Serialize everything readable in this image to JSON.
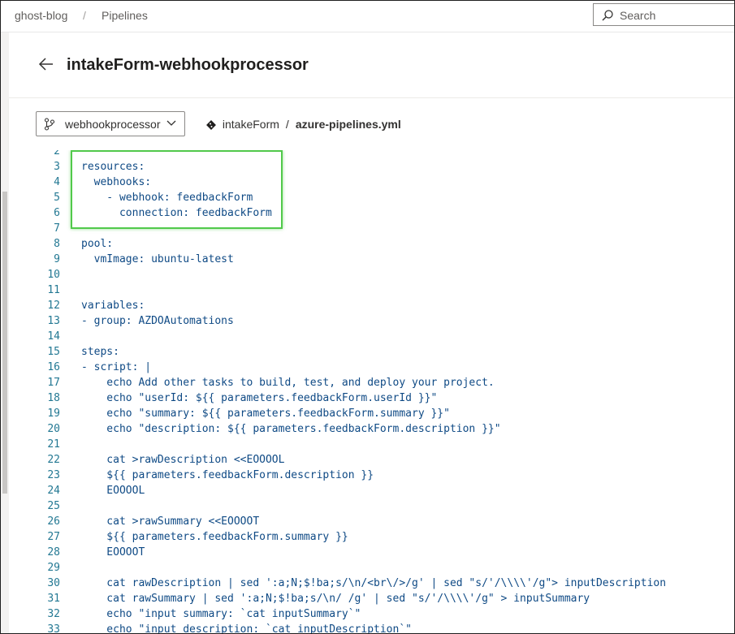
{
  "breadcrumb": {
    "project": "ghost-blog",
    "separator": "/",
    "section": "Pipelines"
  },
  "search": {
    "placeholder": "Search"
  },
  "page": {
    "title": "intakeForm-webhookprocessor"
  },
  "branch": {
    "name": "webhookprocessor"
  },
  "filepath": {
    "repo": "intakeForm",
    "separator": "/",
    "file": "azure-pipelines.yml"
  },
  "colors": {
    "highlight_border": "#51c94b",
    "code_text": "#0f4a85",
    "line_number": "#237893"
  },
  "code_lines": [
    {
      "n": "2",
      "t": ""
    },
    {
      "n": "3",
      "t": "resources:"
    },
    {
      "n": "4",
      "t": "  webhooks:"
    },
    {
      "n": "5",
      "t": "    - webhook: feedbackForm"
    },
    {
      "n": "6",
      "t": "      connection: feedbackForm"
    },
    {
      "n": "7",
      "t": ""
    },
    {
      "n": "8",
      "t": "pool:"
    },
    {
      "n": "9",
      "t": "  vmImage: ubuntu-latest"
    },
    {
      "n": "10",
      "t": ""
    },
    {
      "n": "11",
      "t": ""
    },
    {
      "n": "12",
      "t": "variables:"
    },
    {
      "n": "13",
      "t": "- group: AZDOAutomations"
    },
    {
      "n": "14",
      "t": ""
    },
    {
      "n": "15",
      "t": "steps:"
    },
    {
      "n": "16",
      "t": "- script: |"
    },
    {
      "n": "17",
      "t": "    echo Add other tasks to build, test, and deploy your project."
    },
    {
      "n": "18",
      "t": "    echo \"userId: ${{ parameters.feedbackForm.userId }}\""
    },
    {
      "n": "19",
      "t": "    echo \"summary: ${{ parameters.feedbackForm.summary }}\""
    },
    {
      "n": "20",
      "t": "    echo \"description: ${{ parameters.feedbackForm.description }}\""
    },
    {
      "n": "21",
      "t": ""
    },
    {
      "n": "22",
      "t": "    cat >rawDescription <<EOOOOL"
    },
    {
      "n": "23",
      "t": "    ${{ parameters.feedbackForm.description }}"
    },
    {
      "n": "24",
      "t": "    EOOOOL"
    },
    {
      "n": "25",
      "t": ""
    },
    {
      "n": "26",
      "t": "    cat >rawSummary <<EOOOOT"
    },
    {
      "n": "27",
      "t": "    ${{ parameters.feedbackForm.summary }}"
    },
    {
      "n": "28",
      "t": "    EOOOOT"
    },
    {
      "n": "29",
      "t": ""
    },
    {
      "n": "30",
      "t": "    cat rawDescription | sed ':a;N;$!ba;s/\\n/<br\\/>/g' | sed \"s/'/\\\\\\\\'/g\"> inputDescription"
    },
    {
      "n": "31",
      "t": "    cat rawSummary | sed ':a;N;$!ba;s/\\n/ /g' | sed \"s/'/\\\\\\\\'/g\" > inputSummary"
    },
    {
      "n": "32",
      "t": "    echo \"input summary: `cat inputSummary`\""
    },
    {
      "n": "33",
      "t": "    echo \"input description: `cat inputDescription`\""
    }
  ]
}
